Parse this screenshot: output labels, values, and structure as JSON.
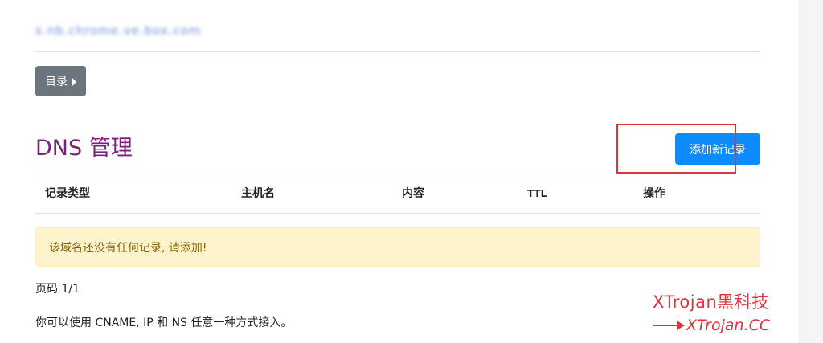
{
  "header": {
    "domain_name": "s.nb.chrome.ve.box.com"
  },
  "menu": {
    "label": "目录"
  },
  "dns": {
    "title": "DNS 管理",
    "add_record_label": "添加新记录"
  },
  "table": {
    "columns": [
      "记录类型",
      "主机名",
      "内容",
      "TTL",
      "操作"
    ],
    "rows": []
  },
  "alert": {
    "message": "该域名还没有任何记录, 请添加!"
  },
  "pagination": {
    "text": "页码 1/1"
  },
  "footnote": {
    "text": "你可以使用 CNAME, IP 和 NS 任意一种方式接入。"
  },
  "watermark": {
    "brand": "XTrojan黑科技",
    "url": "XTrojan.CC"
  },
  "colors": {
    "title_purple": "#7b1f7a",
    "primary_blue": "#0d8bfd",
    "secondary_gray": "#6c757d",
    "alert_bg": "#fff3cd",
    "alert_text": "#856404",
    "highlight_red": "#e0323c"
  },
  "icons": {
    "menu_caret": "caret-right-icon",
    "watermark_arrow": "arrow-icon"
  }
}
